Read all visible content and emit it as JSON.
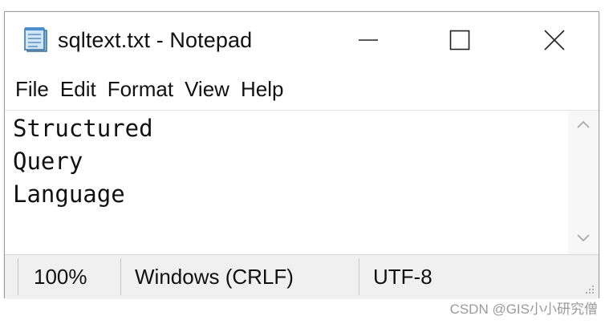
{
  "window": {
    "title": "sqltext.txt - Notepad",
    "icon": "notepad-icon",
    "controls": {
      "minimize_icon": "minimize-icon",
      "maximize_icon": "maximize-icon",
      "close_icon": "close-icon"
    }
  },
  "menu": {
    "items": [
      {
        "label": "File"
      },
      {
        "label": "Edit"
      },
      {
        "label": "Format"
      },
      {
        "label": "View"
      },
      {
        "label": "Help"
      }
    ]
  },
  "editor": {
    "lines": [
      "Structured",
      "Query",
      "Language"
    ],
    "scrollbar": {
      "up_icon": "chevron-up-icon",
      "down_icon": "chevron-down-icon"
    }
  },
  "status": {
    "zoom": "100%",
    "line_ending": "Windows (CRLF)",
    "encoding": "UTF-8"
  },
  "watermark": "CSDN @GIS小小研究僧",
  "colors": {
    "window_border": "#9a9a9a",
    "status_background": "#f0f0f0",
    "text": "#111111",
    "watermark": "#9a9a9a"
  }
}
